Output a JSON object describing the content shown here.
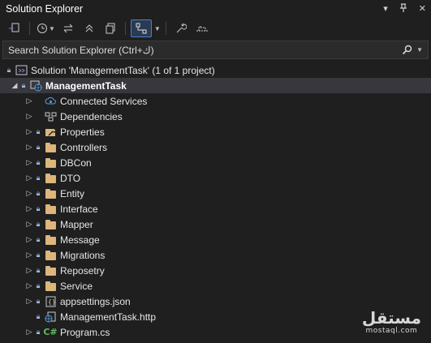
{
  "window": {
    "title": "Solution Explorer",
    "controls": [
      "▾",
      "⊓",
      "✕"
    ]
  },
  "toolbar": {
    "buttons": [
      "sync-with-active-document",
      "home",
      "pending-changes-filter",
      "collapse-all",
      "show-all-files",
      "preview-selected",
      "properties",
      "toggle-view"
    ]
  },
  "search": {
    "placeholder": "Search Solution Explorer (Ctrl+ك)",
    "icon": "search-icon"
  },
  "tree": {
    "solution": "Solution 'ManagementTask' (1 of 1 project)",
    "project": "ManagementTask",
    "items": [
      {
        "label": "Connected Services",
        "icon": "cloud-icon"
      },
      {
        "label": "Dependencies",
        "icon": "dependencies-icon"
      },
      {
        "label": "Properties",
        "icon": "properties-icon"
      },
      {
        "label": "Controllers",
        "icon": "folder-icon"
      },
      {
        "label": "DBCon",
        "icon": "folder-icon"
      },
      {
        "label": "DTO",
        "icon": "folder-icon"
      },
      {
        "label": "Entity",
        "icon": "folder-icon"
      },
      {
        "label": "Interface",
        "icon": "folder-icon"
      },
      {
        "label": "Mapper",
        "icon": "folder-icon"
      },
      {
        "label": "Message",
        "icon": "folder-icon"
      },
      {
        "label": "Migrations",
        "icon": "folder-icon"
      },
      {
        "label": "Reposetry",
        "icon": "folder-icon"
      },
      {
        "label": "Service",
        "icon": "folder-icon"
      },
      {
        "label": "appsettings.json",
        "icon": "json-file-icon"
      },
      {
        "label": "ManagementTask.http",
        "icon": "http-file-icon"
      },
      {
        "label": "Program.cs",
        "icon": "csharp-file-icon",
        "glyph": "C#"
      }
    ]
  },
  "watermark": {
    "arabic": "مستقل",
    "latin": "mostaql.com"
  },
  "colors": {
    "background": "#1f1f1f",
    "selected_row": "#37373d",
    "folder": "#dcb67a",
    "accent": "#4a7fc8"
  }
}
